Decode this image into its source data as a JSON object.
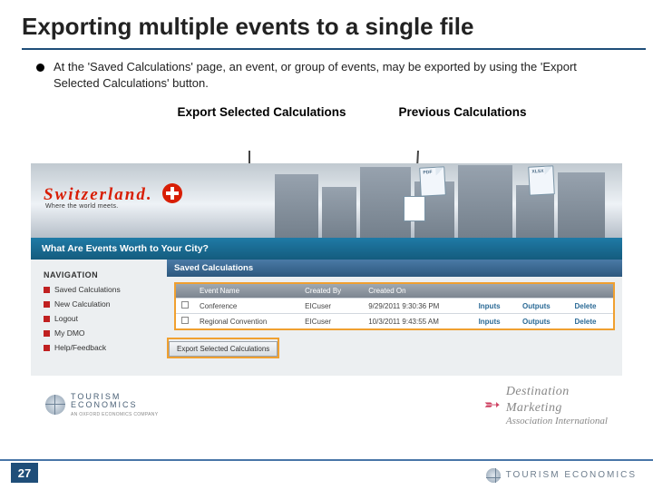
{
  "title": "Exporting multiple events to a single file",
  "bullet": "At the 'Saved Calculations' page, an event, or group of events, may be exported by using the 'Export Selected Calculations' button.",
  "callouts": {
    "left": "Export Selected Calculations",
    "right": "Previous Calculations"
  },
  "screenshot": {
    "banner": {
      "brand": "Switzerland.",
      "tagline": "Where the world meets."
    },
    "question_bar": "What Are Events Worth to Your City?",
    "navigation": {
      "title": "NAVIGATION",
      "items": [
        "Saved Calculations",
        "New Calculation",
        "Logout",
        "My DMO",
        "Help/Feedback"
      ]
    },
    "saved": {
      "heading": "Saved Calculations",
      "columns": [
        "",
        "Event Name",
        "Created By",
        "Created On",
        "",
        "",
        ""
      ],
      "rows": [
        {
          "name": "Conference",
          "by": "EICuser",
          "on": "9/29/2011 9:30:36 PM",
          "a": "Inputs",
          "b": "Outputs",
          "c": "Delete"
        },
        {
          "name": "Regional Convention",
          "by": "EICuser",
          "on": "10/3/2011 9:43:55 AM",
          "a": "Inputs",
          "b": "Outputs",
          "c": "Delete"
        }
      ],
      "export_button": "Export Selected Calculations"
    },
    "footer": {
      "left_brand1": "TOURISM",
      "left_brand2": "ECONOMICS",
      "left_sub": "AN OXFORD ECONOMICS COMPANY",
      "right1": "Destination",
      "right2": "Marketing",
      "right3": "Association International"
    }
  },
  "page_number": "27",
  "footer_brand1": "TOURISM",
  "footer_brand2": "ECONOMICS"
}
